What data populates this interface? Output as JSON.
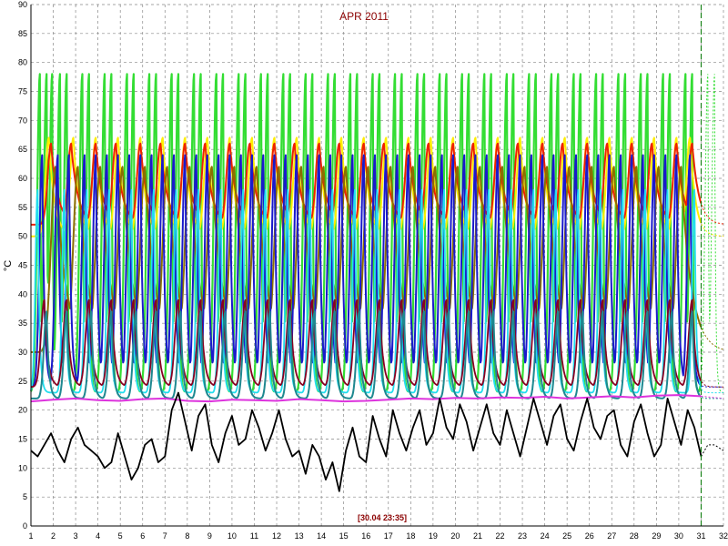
{
  "chart_data": {
    "type": "line",
    "title": "APR 2011",
    "ylabel": "°C",
    "xlabel": "",
    "cursor_label": "[30.04 23:35]",
    "xlim": [
      1,
      32
    ],
    "ylim": [
      0,
      90
    ],
    "x_ticks": [
      1,
      2,
      3,
      4,
      5,
      6,
      7,
      8,
      9,
      10,
      11,
      12,
      13,
      14,
      15,
      16,
      17,
      18,
      19,
      20,
      21,
      22,
      23,
      24,
      25,
      26,
      27,
      28,
      29,
      30,
      31,
      32
    ],
    "y_ticks": [
      0,
      5,
      10,
      15,
      20,
      25,
      30,
      35,
      40,
      45,
      50,
      55,
      60,
      65,
      70,
      75,
      80,
      85,
      90
    ],
    "grid": true,
    "current_time_marker": 31,
    "series": [
      {
        "color": "#33dd33",
        "width": 2.2,
        "base": 23,
        "peak": 78,
        "decay": 0.05,
        "rise": 0.12,
        "dash_after": 31,
        "peaks": [
          1.4,
          1.7,
          1.95,
          2.3,
          2.6,
          3.3,
          3.6,
          4.3,
          4.6,
          5.3,
          5.6,
          6.3,
          6.6,
          7.3,
          7.6,
          8.3,
          8.6,
          9.3,
          9.6,
          10.3,
          10.6,
          11.3,
          11.6,
          12.3,
          12.6,
          13.3,
          13.6,
          14.3,
          14.6,
          15.3,
          15.6,
          16.3,
          16.6,
          17.3,
          17.6,
          18.3,
          18.6,
          19.3,
          19.6,
          20.3,
          20.6,
          21.3,
          21.6,
          22.3,
          22.6,
          23.3,
          23.6,
          24.3,
          24.6,
          25.3,
          25.6,
          26.3,
          26.6,
          27.3,
          27.6,
          28.3,
          28.6,
          29.3,
          29.6,
          30.3,
          30.6,
          31.3,
          31.6
        ]
      },
      {
        "color": "#ffee00",
        "width": 2.0,
        "base": 50,
        "peak": 67,
        "decay": 0.25,
        "rise": 0.15,
        "dash_after": 31,
        "peaks": [
          1.8,
          2.9,
          3.9,
          4.9,
          5.9,
          6.9,
          7.9,
          8.9,
          9.9,
          10.9,
          11.9,
          12.9,
          13.9,
          14.9,
          15.9,
          16.9,
          17.9,
          18.9,
          19.9,
          20.9,
          21.9,
          22.9,
          23.9,
          24.9,
          25.9,
          26.9,
          27.9,
          28.9,
          29.9,
          30.5
        ]
      },
      {
        "color": "#ee2200",
        "width": 2.0,
        "base": 52,
        "peak": 66,
        "decay": 0.3,
        "rise": 0.15,
        "dash_after": 31,
        "peaks": [
          1.9,
          2.8,
          3.9,
          4.8,
          5.9,
          6.8,
          7.9,
          8.8,
          9.9,
          10.8,
          11.9,
          12.8,
          13.9,
          14.8,
          15.9,
          16.8,
          17.9,
          18.8,
          19.9,
          20.8,
          21.9,
          22.8,
          23.9,
          24.8,
          25.9,
          26.8,
          27.9,
          28.8,
          29.9,
          30.6
        ]
      },
      {
        "color": "#8b6f00",
        "width": 2.0,
        "base": 30,
        "peak": 62,
        "decay": 0.45,
        "rise": 0.2,
        "dash_after": 31,
        "peaks": [
          2.1,
          3.1,
          4.1,
          5.1,
          6.1,
          7.1,
          8.1,
          9.1,
          10.1,
          11.1,
          12.1,
          13.1,
          14.1,
          15.1,
          16.1,
          17.1,
          18.1,
          19.1,
          20.1,
          21.1,
          22.1,
          23.1,
          24.1,
          25.1,
          26.1,
          27.1,
          28.1,
          29.1,
          30.1
        ]
      },
      {
        "color": "#1a1acc",
        "width": 2.0,
        "base": 24,
        "peak": 64,
        "decay": 0.1,
        "rise": 0.12,
        "dash_after": 31,
        "peaks": [
          1.5,
          2.2,
          2.7,
          3.4,
          3.9,
          4.4,
          4.9,
          5.4,
          5.9,
          6.4,
          6.9,
          7.4,
          7.9,
          8.4,
          8.9,
          9.4,
          9.9,
          10.4,
          10.9,
          11.4,
          11.9,
          12.4,
          12.9,
          13.4,
          13.9,
          14.4,
          14.9,
          15.4,
          15.9,
          16.4,
          16.9,
          17.4,
          17.9,
          18.4,
          18.9,
          19.4,
          19.9,
          20.4,
          20.9,
          21.4,
          21.9,
          22.4,
          22.9,
          23.4,
          23.9,
          24.4,
          24.9,
          25.4,
          25.9,
          26.4,
          26.9,
          27.4,
          27.9,
          28.4,
          28.9,
          29.4,
          29.9,
          30.5
        ]
      },
      {
        "color": "#22ddee",
        "width": 1.8,
        "base": 23,
        "peak": 58,
        "decay": 0.08,
        "rise": 0.1,
        "dash_after": 31,
        "peaks": [
          1.3,
          2.5,
          3.5,
          4.5,
          5.5,
          6.5,
          7.5,
          8.5,
          9.5,
          10.5,
          11.5,
          12.5,
          13.5,
          14.5,
          15.5,
          16.5,
          17.5,
          18.5,
          19.5,
          20.5,
          21.5,
          22.5,
          23.5,
          24.5,
          25.5,
          26.5,
          27.5,
          28.5,
          29.5,
          30.7
        ]
      },
      {
        "color": "#880022",
        "width": 1.8,
        "base": 24,
        "peak": 39,
        "decay": 0.15,
        "rise": 0.15,
        "dash_after": 31,
        "peaks": [
          1.6,
          2.6,
          3.6,
          4.6,
          5.6,
          6.6,
          7.6,
          8.6,
          9.6,
          10.6,
          11.6,
          12.6,
          13.6,
          14.6,
          15.6,
          16.6,
          17.6,
          18.6,
          19.6,
          20.6,
          21.6,
          22.6,
          23.6,
          24.6,
          25.6,
          26.6,
          27.6,
          28.6,
          29.6,
          30.6
        ]
      },
      {
        "color": "#1e8890",
        "width": 2.0,
        "base": 22,
        "peak": 37,
        "decay": 0.1,
        "rise": 0.12,
        "dash_after": 31,
        "peaks": [
          1.7,
          2.6,
          3.7,
          4.6,
          5.7,
          6.6,
          7.7,
          8.6,
          9.7,
          10.6,
          11.7,
          12.6,
          13.7,
          14.6,
          15.7,
          16.6,
          17.7,
          18.6,
          19.7,
          20.6,
          21.7,
          22.6,
          23.7,
          24.6,
          25.7,
          26.6,
          27.7,
          28.6,
          29.7,
          30.6
        ]
      },
      {
        "color": "#dd33dd",
        "width": 2.0,
        "flat": true,
        "dash_after": 31,
        "x": [
          1,
          2,
          3,
          4,
          5,
          6,
          7,
          8,
          9,
          10,
          11,
          12,
          13,
          14,
          15,
          16,
          17,
          18,
          19,
          20,
          21,
          22,
          23,
          24,
          25,
          26,
          27,
          28,
          29,
          30,
          31,
          32
        ],
        "values": [
          21.5,
          21.8,
          22.0,
          21.7,
          21.6,
          21.9,
          22.0,
          21.6,
          21.5,
          21.8,
          21.7,
          21.6,
          21.9,
          21.7,
          21.5,
          21.6,
          21.8,
          22.0,
          21.9,
          22.1,
          22.0,
          22.2,
          22.1,
          22.3,
          22.0,
          22.2,
          22.4,
          22.2,
          22.5,
          22.6,
          22.4,
          22.0
        ]
      },
      {
        "color": "#000000",
        "width": 1.8,
        "flat": true,
        "dash_after": 31,
        "x": [
          1,
          1.3,
          1.6,
          1.9,
          2.2,
          2.5,
          2.8,
          3.1,
          3.4,
          3.7,
          4.0,
          4.3,
          4.6,
          4.9,
          5.2,
          5.5,
          5.8,
          6.1,
          6.4,
          6.7,
          7.0,
          7.3,
          7.6,
          7.9,
          8.2,
          8.5,
          8.8,
          9.1,
          9.4,
          9.7,
          10.0,
          10.3,
          10.6,
          10.9,
          11.2,
          11.5,
          11.8,
          12.1,
          12.4,
          12.7,
          13.0,
          13.3,
          13.6,
          13.9,
          14.2,
          14.5,
          14.8,
          15.1,
          15.4,
          15.7,
          16.0,
          16.3,
          16.6,
          16.9,
          17.2,
          17.5,
          17.8,
          18.1,
          18.4,
          18.7,
          19.0,
          19.3,
          19.6,
          19.9,
          20.2,
          20.5,
          20.8,
          21.1,
          21.4,
          21.7,
          22.0,
          22.3,
          22.6,
          22.9,
          23.2,
          23.5,
          23.8,
          24.1,
          24.4,
          24.7,
          25.0,
          25.3,
          25.6,
          25.9,
          26.2,
          26.5,
          26.8,
          27.1,
          27.4,
          27.7,
          28.0,
          28.3,
          28.6,
          28.9,
          29.2,
          29.5,
          29.8,
          30.1,
          30.4,
          30.7,
          31.0,
          31.3,
          31.6,
          32.0
        ],
        "values": [
          13,
          12,
          14,
          16,
          13,
          11,
          15,
          17,
          14,
          13,
          12,
          10,
          11,
          16,
          12,
          8,
          10,
          14,
          15,
          11,
          12,
          20,
          23,
          18,
          13,
          19,
          21,
          14,
          11,
          16,
          19,
          14,
          15,
          20,
          17,
          13,
          16,
          20,
          15,
          12,
          13,
          9,
          14,
          12,
          8,
          11,
          6,
          13,
          17,
          12,
          11,
          19,
          15,
          12,
          20,
          16,
          13,
          17,
          20,
          14,
          16,
          22,
          17,
          15,
          21,
          18,
          13,
          17,
          21,
          16,
          14,
          20,
          16,
          12,
          17,
          22,
          18,
          14,
          19,
          21,
          15,
          13,
          18,
          22,
          17,
          15,
          19,
          20,
          14,
          12,
          18,
          21,
          16,
          12,
          14,
          22,
          18,
          14,
          20,
          17,
          12,
          14,
          14,
          13
        ]
      }
    ]
  }
}
